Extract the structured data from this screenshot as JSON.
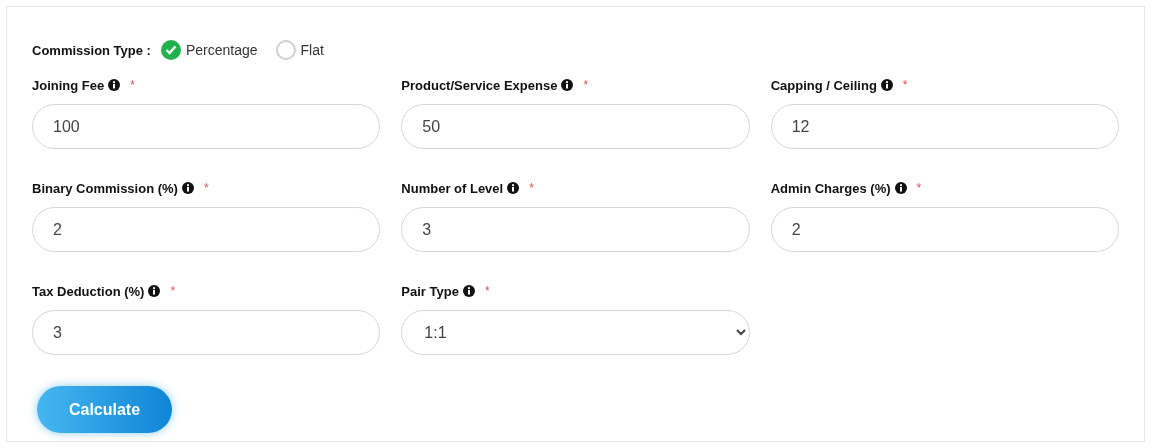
{
  "commission_type": {
    "label": "Commission Type :",
    "options": [
      {
        "label": "Percentage",
        "selected": true
      },
      {
        "label": "Flat",
        "selected": false
      }
    ]
  },
  "fields": [
    {
      "kind": "input",
      "label": "Joining Fee",
      "required_mark": "*",
      "value": "100"
    },
    {
      "kind": "input",
      "label": "Product/Service Expense",
      "required_mark": "*",
      "value": "50"
    },
    {
      "kind": "input",
      "label": "Capping / Ceiling",
      "required_mark": "*",
      "value": "12"
    },
    {
      "kind": "input",
      "label": "Binary Commission (%)",
      "required_mark": "*",
      "value": "2"
    },
    {
      "kind": "input",
      "label": "Number of Level",
      "required_mark": "*",
      "value": "3"
    },
    {
      "kind": "input",
      "label": "Admin Charges (%)",
      "required_mark": "*",
      "value": "2"
    },
    {
      "kind": "input",
      "label": "Tax Deduction (%)",
      "required_mark": "*",
      "value": "3"
    },
    {
      "kind": "select",
      "label": "Pair Type",
      "required_mark": "*",
      "value": "1:1"
    }
  ],
  "calculate_button": "Calculate"
}
